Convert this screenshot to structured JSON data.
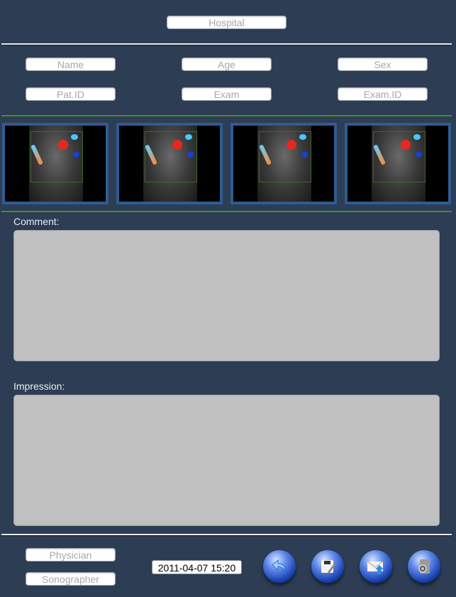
{
  "header": {
    "hospital_placeholder": "Hospital"
  },
  "patient": {
    "name_placeholder": "Name",
    "age_placeholder": "Age",
    "sex_placeholder": "Sex",
    "patid_placeholder": "Pat.ID",
    "exam_placeholder": "Exam",
    "examid_placeholder": "Exam.ID"
  },
  "thumbnails": [
    {
      "name": "ultrasound-image-1"
    },
    {
      "name": "ultrasound-image-2"
    },
    {
      "name": "ultrasound-image-3"
    },
    {
      "name": "ultrasound-image-4"
    }
  ],
  "comment": {
    "label": "Comment:",
    "value": ""
  },
  "impression": {
    "label": "Impression:",
    "value": ""
  },
  "footer": {
    "physician_placeholder": "Physician",
    "sonographer_placeholder": "Sonographer",
    "datetime": "2011-04-07 15:20",
    "buttons": [
      {
        "icon": "back-arrow-icon"
      },
      {
        "icon": "save-edit-icon"
      },
      {
        "icon": "email-send-icon"
      },
      {
        "icon": "settings-icon"
      }
    ]
  },
  "colors": {
    "background": "#2c3d54",
    "textarea": "#c0c0c0",
    "thumb_border": "#2f5b91",
    "divider_green": "#4a8a2e"
  }
}
